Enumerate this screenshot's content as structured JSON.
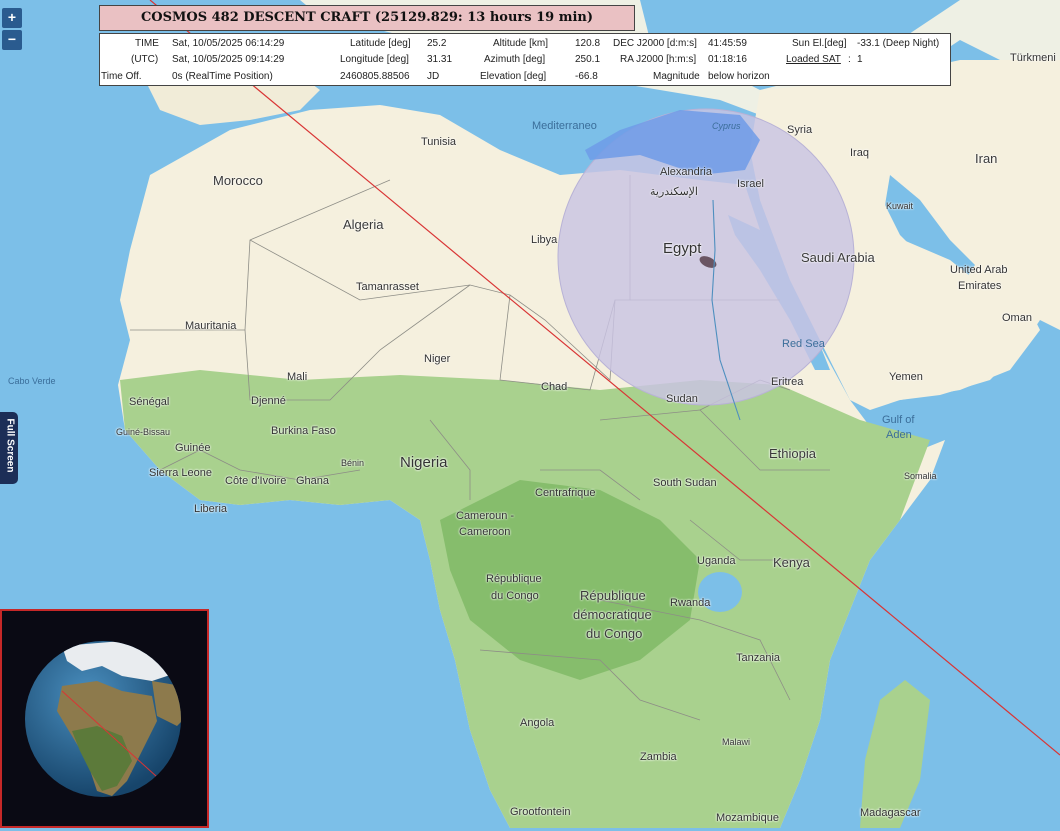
{
  "header": {
    "title": "COSMOS 482 DESCENT CRAFT (25129.829: 13 hours 19 min)"
  },
  "info": {
    "time_label": "TIME",
    "time_value": "Sat, 10/05/2025 06:14:29",
    "utc_label": "(UTC)",
    "utc_value": "Sat, 10/05/2025 09:14:29",
    "offset_label": "Time Off.",
    "offset_value": "0s (RealTime Position)",
    "latitude_label": "Latitude [deg]",
    "latitude_value": "25.2",
    "longitude_label": "Longitude [deg]",
    "longitude_value": "31.31",
    "jd_value": "2460805.88506",
    "jd_label": "JD",
    "altitude_label": "Altitude [km]",
    "altitude_value": "120.8",
    "azimuth_label": "Azimuth [deg]",
    "azimuth_value": "250.1",
    "elevation_label": "Elevation [deg]",
    "elevation_value": "-66.8",
    "dec_label": "DEC J2000 [d:m:s]",
    "dec_value": "41:45:59",
    "ra_label": "RA J2000 [h:m:s]",
    "ra_value": "01:18:16",
    "magnitude_label": "Magnitude",
    "magnitude_value": "below horizon",
    "sun_label": "Sun El.[deg]",
    "sun_value": "-33.1 (Deep Night)",
    "loaded_label": "Loaded SAT",
    "loaded_sep": ":",
    "loaded_value": "1"
  },
  "controls": {
    "zoom_in": "+",
    "zoom_out": "−",
    "fullscreen": "Full Screen"
  },
  "map_labels": {
    "morocco": "Morocco",
    "algeria": "Algeria",
    "tunisia": "Tunisia",
    "libya": "Libya",
    "egypt": "Egypt",
    "alexandria": "Alexandria",
    "alexandria_ar": "الإسكندرية",
    "israel": "Israel",
    "syria": "Syria",
    "iraq": "Iraq",
    "iran": "Iran",
    "kuwait": "Kuwait",
    "saudi_arabia": "Saudi Arabia",
    "uae_1": "United Arab",
    "uae_2": "Emirates",
    "oman": "Oman",
    "yemen": "Yemen",
    "gulf_aden_1": "Gulf of",
    "gulf_aden_2": "Aden",
    "red_sea": "Red Sea",
    "cyprus": "Cyprus",
    "mediterraneo": "Mediterraneo",
    "turkmeni": "Türkmeni",
    "tamanrasset": "Tamanrasset",
    "mauritania": "Mauritania",
    "mali": "Mali",
    "niger": "Niger",
    "chad": "Chad",
    "sudan": "Sudan",
    "eritrea": "Eritrea",
    "ethiopia": "Ethiopia",
    "somalia": "Somalia",
    "cabo_verde": "Cabo Verde",
    "senegal": "Sénégal",
    "guinee_bissau": "Guiné-Bissau",
    "guinee": "Guinée",
    "sierra_leone": "Sierra Leone",
    "liberia": "Liberia",
    "cote_ivoire": "Côte d'Ivoire",
    "ghana": "Ghana",
    "djenne": "Djenné",
    "burkina_faso": "Burkina Faso",
    "benin": "Bénin",
    "nigeria": "Nigeria",
    "centrafrique": "Centrafrique",
    "south_sudan": "South Sudan",
    "cameroun_1": "Cameroun -",
    "cameroun_2": "Cameroon",
    "rep_congo_1": "République",
    "rep_congo_2": "du Congo",
    "rdc_1": "République",
    "rdc_2": "démocratique",
    "rdc_3": "du Congo",
    "uganda": "Uganda",
    "kenya": "Kenya",
    "rwanda": "Rwanda",
    "tanzania": "Tanzania",
    "angola": "Angola",
    "zambia": "Zambia",
    "malawi": "Malawi",
    "grootfontein": "Grootfontein",
    "mozambique": "Mozambique",
    "madagascar": "Madagascar"
  },
  "colors": {
    "ocean": "#7cbfe8",
    "land": "#f5f0de",
    "vegetation": "#a9d18e",
    "forest": "#86bd6c",
    "footprint": "#c9c3e3",
    "track": "#d93535",
    "title_bg": "#eac1c3",
    "control_bg": "#2a5b8f"
  }
}
